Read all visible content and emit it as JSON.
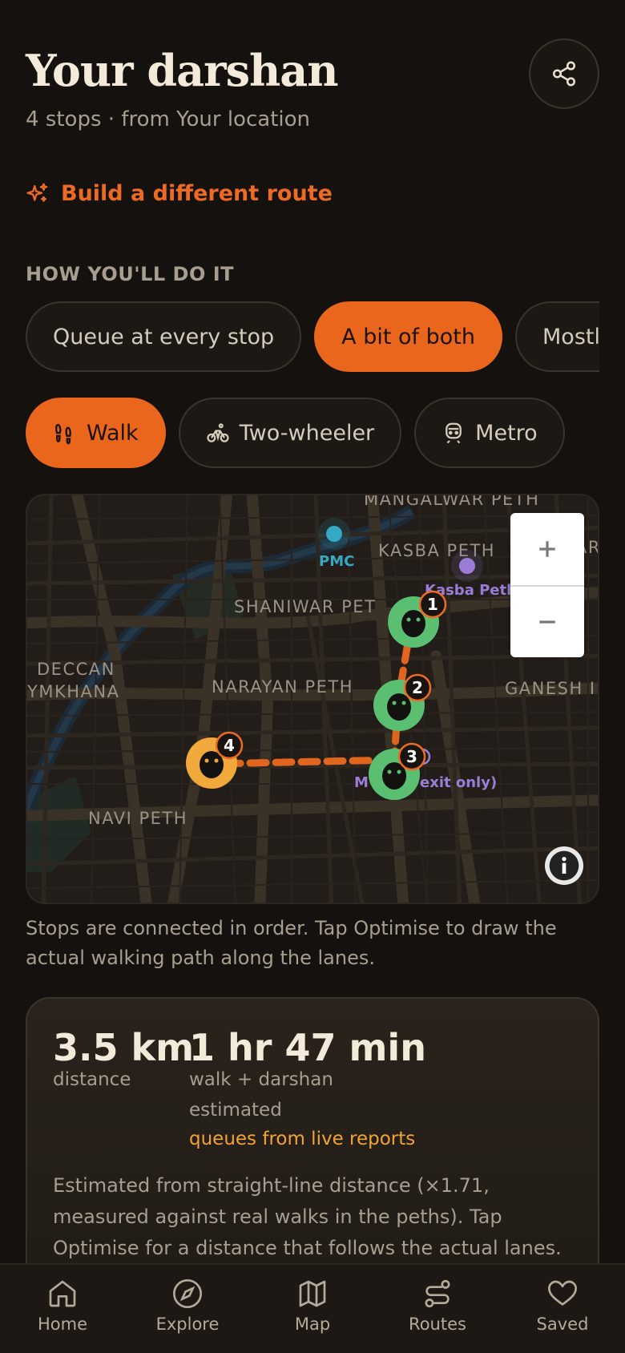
{
  "header": {
    "title": "Your darshan",
    "subtitle": "4 stops · from Your location",
    "share_icon": "share-icon"
  },
  "build_link": {
    "label": "Build a different route",
    "icon": "sparkles-icon"
  },
  "section_label": "HOW YOU'LL DO IT",
  "queue_modes": [
    {
      "label": "Queue at every stop",
      "active": false
    },
    {
      "label": "A bit of both",
      "active": true
    },
    {
      "label": "Mostly fro",
      "active": false
    }
  ],
  "travel_modes": [
    {
      "label": "Walk",
      "icon": "footprints-icon",
      "active": true
    },
    {
      "label": "Two-wheeler",
      "icon": "bike-icon",
      "active": false
    },
    {
      "label": "Metro",
      "icon": "train-icon",
      "active": false
    }
  ],
  "map": {
    "places": {
      "mangalwar": "MANGALWAR PETH",
      "kasba": "KASBA PETH",
      "shaniwar": "SHANIWAR PET",
      "deccan1": "DECCAN",
      "deccan2": "YMKHANA",
      "narayan": "NARAYAN PETH",
      "ganesh": "GANESH I",
      "navi": "NAVI PETH",
      "edge": "AR"
    },
    "metro": {
      "pmc": "PMC",
      "kasba_station": "Kasba Peth",
      "mandai_a": "M",
      "mandai_b": "exit only)"
    },
    "stops": [
      "1",
      "2",
      "3",
      "4"
    ],
    "zoom_in": "+",
    "zoom_out": "−",
    "info_icon": "info-icon"
  },
  "map_caption": "Stops are connected in order. Tap Optimise to draw the actual walking path along the lanes.",
  "stats": {
    "distance_value": "3.5 km",
    "distance_label": "distance",
    "time_value": "1 hr 47 min",
    "time_label": "walk + darshan",
    "time_estimated": "estimated",
    "time_live": "queues from live reports",
    "note": "Estimated from straight-line distance (×1.71, measured against real walks in the peths). Tap Optimise for a distance that follows the actual lanes."
  },
  "nav": [
    {
      "label": "Home",
      "icon": "home-icon"
    },
    {
      "label": "Explore",
      "icon": "compass-icon"
    },
    {
      "label": "Map",
      "icon": "map-icon"
    },
    {
      "label": "Routes",
      "icon": "routes-icon"
    },
    {
      "label": "Saved",
      "icon": "heart-icon"
    }
  ],
  "colors": {
    "accent": "#ea661d",
    "stop_visited": "#5bbf72",
    "stop_start": "#f0a93a",
    "metro_blue": "#36a8c4",
    "metro_purple": "#9b7dd8",
    "live": "#f0a436"
  }
}
